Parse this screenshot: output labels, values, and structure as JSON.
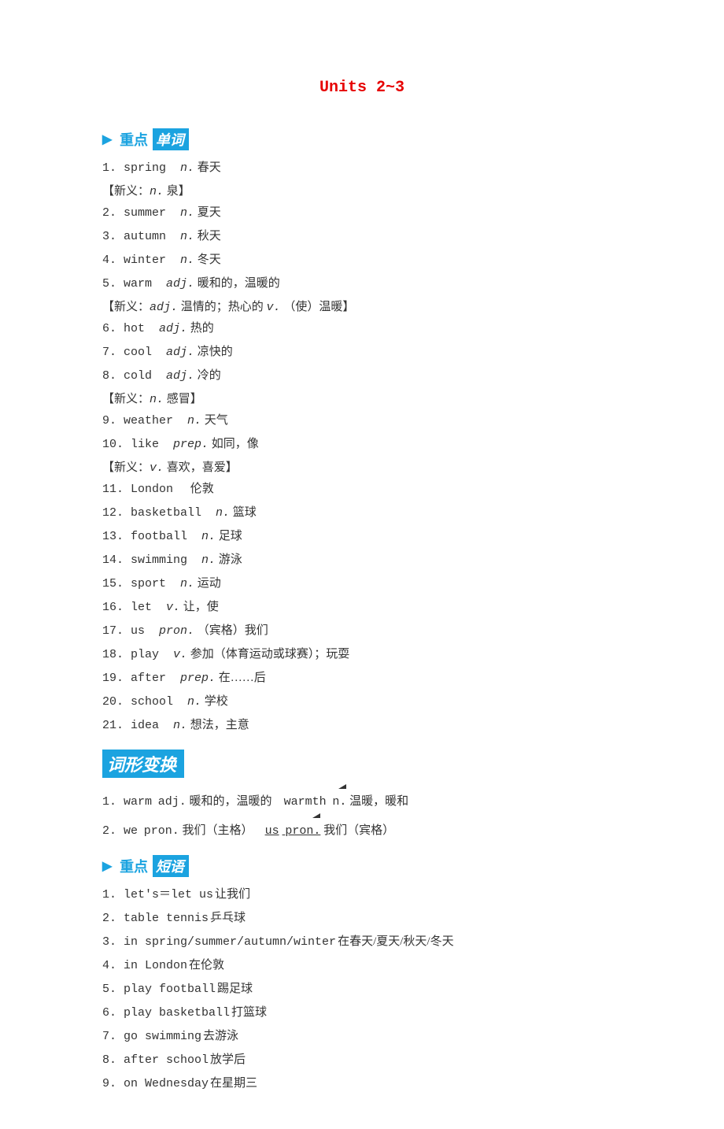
{
  "title": "Units 2~3",
  "headings": {
    "vocab_arrow": "▶",
    "vocab_label": "重点",
    "vocab_box": "单词",
    "forms_box": "词形变换",
    "phrases_arrow": "▶",
    "phrases_label": "重点",
    "phrases_box": "短语"
  },
  "vocab": [
    {
      "num": "1. ",
      "word": "spring",
      "pos": "n.",
      "def": " 春天"
    },
    {
      "note": "【新义：",
      "note_pos": "n.",
      "note_rest": " 泉】"
    },
    {
      "num": "2. ",
      "word": "summer",
      "pos": "n.",
      "def": " 夏天"
    },
    {
      "num": "3. ",
      "word": "autumn",
      "pos": "n.",
      "def": " 秋天"
    },
    {
      "num": "4. ",
      "word": "winter",
      "pos": "n.",
      "def": " 冬天"
    },
    {
      "num": "5. ",
      "word": "warm",
      "pos": "adj.",
      "def": " 暖和的，温暖的"
    },
    {
      "note": "【新义：",
      "note_pos": "adj.",
      "note_rest": " 温情的；热心的 ",
      "note_pos2": "v.",
      "note_rest2": " （使）温暖】"
    },
    {
      "num": "6. ",
      "word": "hot",
      "pos": "adj.",
      "def": " 热的"
    },
    {
      "num": "7. ",
      "word": "cool",
      "pos": "adj.",
      "def": " 凉快的"
    },
    {
      "num": "8. ",
      "word": "cold",
      "pos": "adj.",
      "def": " 冷的"
    },
    {
      "note": "【新义：",
      "note_pos": "n.",
      "note_rest": " 感冒】"
    },
    {
      "num": "9. ",
      "word": "weather",
      "pos": "n.",
      "def": " 天气"
    },
    {
      "num": "10. ",
      "word": "like",
      "pos": "prep.",
      "def": " 如同，像"
    },
    {
      "note": "【新义：",
      "note_pos": "v.",
      "note_rest": " 喜欢，喜爱】"
    },
    {
      "num": "11. ",
      "word": "London",
      "pos": "",
      "def": " 伦敦"
    },
    {
      "num": "12. ",
      "word": "basketball",
      "pos": "n.",
      "def": " 篮球"
    },
    {
      "num": "13. ",
      "word": "football",
      "pos": "n.",
      "def": " 足球"
    },
    {
      "num": "14. ",
      "word": "swimming",
      "pos": "n.",
      "def": " 游泳"
    },
    {
      "num": "15. ",
      "word": "sport",
      "pos": "n.",
      "def": " 运动"
    },
    {
      "num": "16. ",
      "word": "let",
      "pos": "v.",
      "def": " 让，使"
    },
    {
      "num": "17. ",
      "word": "us",
      "pos": "pron.",
      "def": " （宾格）我们"
    },
    {
      "num": "18. ",
      "word": "play",
      "pos": "v.",
      "def": " 参加（体育运动或球赛）；玩耍"
    },
    {
      "num": "19. ",
      "word": "after",
      "pos": "prep.",
      "def": " 在……后"
    },
    {
      "num": "20. ",
      "word": "school",
      "pos": "n.",
      "def": " 学校"
    },
    {
      "num": "21. ",
      "word": "idea",
      "pos": "n.",
      "def": " 想法，主意"
    }
  ],
  "wordforms": [
    {
      "num": "1. ",
      "left_word": "warm",
      "left_pos": "adj.",
      "left_def": " 暖和的，温暖的",
      "right_word": "warmth",
      "right_pos": "n.",
      "right_def": " 温暖，暖和"
    },
    {
      "num": "2. ",
      "left_word": "we",
      "left_pos": "pron.",
      "left_def": " 我们（主格）",
      "right_word": "us",
      "right_pos": "pron.",
      "right_def": " 我们（宾格）"
    }
  ],
  "phrases": [
    {
      "num": "1. ",
      "en": "let's＝let us",
      "zh": "让我们"
    },
    {
      "num": "2. ",
      "en": "table tennis",
      "zh": "乒乓球"
    },
    {
      "num": "3. ",
      "en": "in spring/summer/autumn/winter",
      "zh": "在春天/夏天/秋天/冬天"
    },
    {
      "num": "4. ",
      "en": "in London",
      "zh": "在伦敦"
    },
    {
      "num": "5. ",
      "en": "play football",
      "zh": "踢足球"
    },
    {
      "num": "6. ",
      "en": "play basketball",
      "zh": "打篮球"
    },
    {
      "num": "7. ",
      "en": "go swimming",
      "zh": "去游泳"
    },
    {
      "num": "8. ",
      "en": "after school",
      "zh": "放学后"
    },
    {
      "num": "9. ",
      "en": "on Wednesday",
      "zh": "在星期三"
    }
  ]
}
